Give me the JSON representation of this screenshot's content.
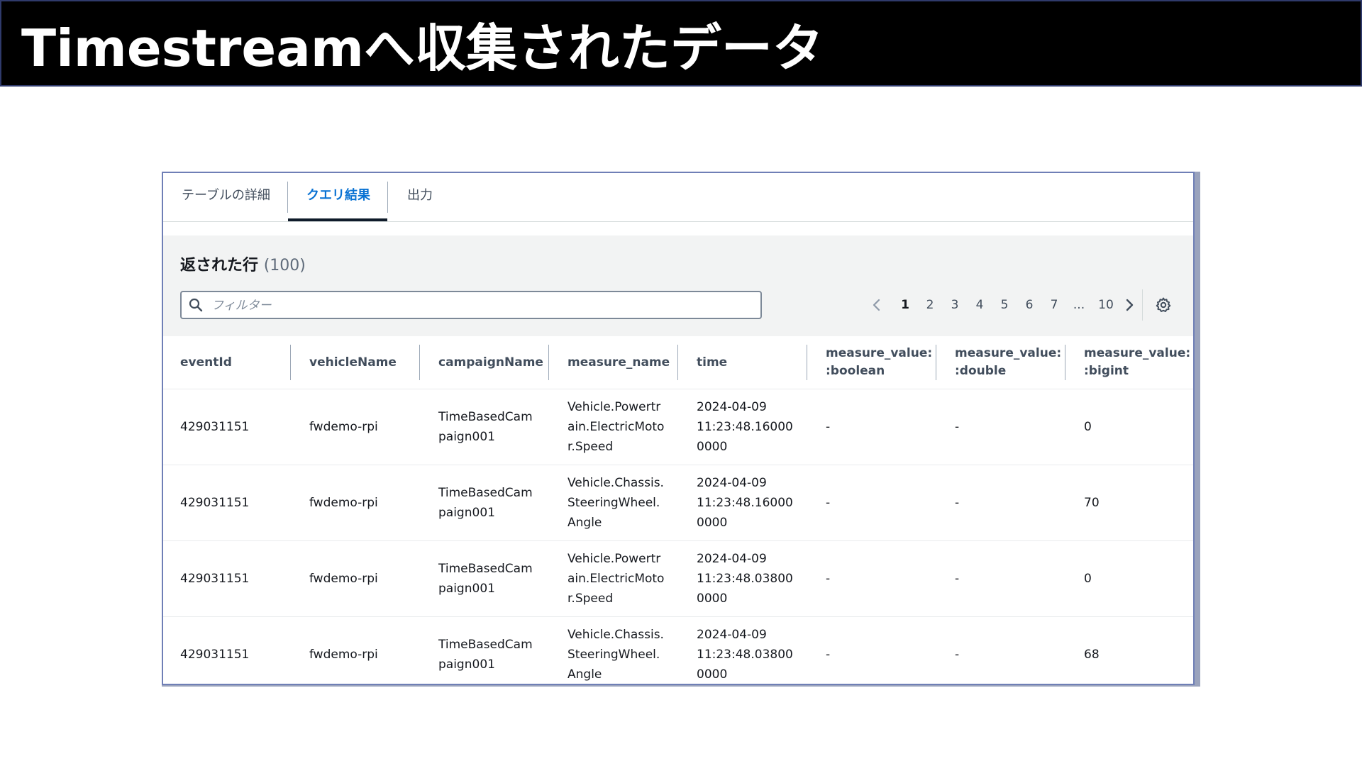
{
  "slide": {
    "title": "Timestreamへ収集されたデータ"
  },
  "tabs": [
    {
      "label": "テーブルの詳細"
    },
    {
      "label": "クエリ結果"
    },
    {
      "label": "出力"
    }
  ],
  "results": {
    "heading": "返された行",
    "count": "(100)",
    "filter_placeholder": "フィルター"
  },
  "pagination": {
    "pages": [
      "1",
      "2",
      "3",
      "4",
      "5",
      "6",
      "7",
      "...",
      "10"
    ],
    "current": "1"
  },
  "table": {
    "headers": [
      [
        "eventId"
      ],
      [
        "vehicleName"
      ],
      [
        "campaignName"
      ],
      [
        "measure_name"
      ],
      [
        "time"
      ],
      [
        "measure_value:",
        ":boolean"
      ],
      [
        "measure_value:",
        ":double"
      ],
      [
        "measure_value:",
        ":bigint"
      ]
    ],
    "rows": [
      {
        "eventId": "429031151",
        "vehicleName": "fwdemo-rpi",
        "campaignName": [
          "TimeBasedCam",
          "paign001"
        ],
        "measure_name": [
          "Vehicle.Powertr",
          "ain.ElectricMoto",
          "r.Speed"
        ],
        "time": [
          "2024-04-09",
          "11:23:48.16000",
          "0000"
        ],
        "boolean": "-",
        "double": "-",
        "bigint": "0"
      },
      {
        "eventId": "429031151",
        "vehicleName": "fwdemo-rpi",
        "campaignName": [
          "TimeBasedCam",
          "paign001"
        ],
        "measure_name": [
          "Vehicle.Chassis.",
          "SteeringWheel.",
          "Angle"
        ],
        "time": [
          "2024-04-09",
          "11:23:48.16000",
          "0000"
        ],
        "boolean": "-",
        "double": "-",
        "bigint": "70"
      },
      {
        "eventId": "429031151",
        "vehicleName": "fwdemo-rpi",
        "campaignName": [
          "TimeBasedCam",
          "paign001"
        ],
        "measure_name": [
          "Vehicle.Powertr",
          "ain.ElectricMoto",
          "r.Speed"
        ],
        "time": [
          "2024-04-09",
          "11:23:48.03800",
          "0000"
        ],
        "boolean": "-",
        "double": "-",
        "bigint": "0"
      },
      {
        "eventId": "429031151",
        "vehicleName": "fwdemo-rpi",
        "campaignName": [
          "TimeBasedCam",
          "paign001"
        ],
        "measure_name": [
          "Vehicle.Chassis.",
          "SteeringWheel.",
          "Angle"
        ],
        "time": [
          "2024-04-09",
          "11:23:48.03800",
          "0000"
        ],
        "boolean": "-",
        "double": "-",
        "bigint": "68"
      }
    ]
  },
  "colors": {
    "accent": "#0972d3",
    "title_bar": "#000000",
    "panel_border": "#6f7fb6"
  },
  "icons": {
    "filter": "search-icon",
    "prev": "chevron-left-icon",
    "next": "chevron-right-icon",
    "preferences": "gear-icon"
  }
}
